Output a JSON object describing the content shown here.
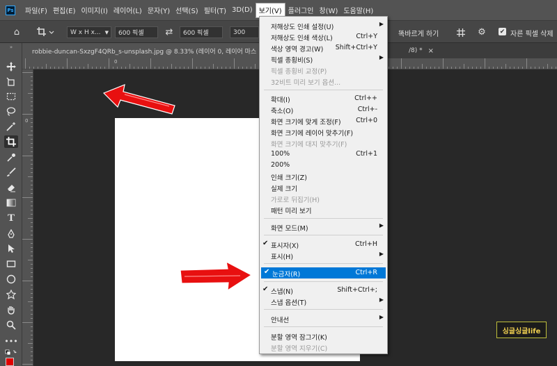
{
  "menubar": {
    "logo": "Ps",
    "items": [
      "파일(F)",
      "편집(E)",
      "이미지(I)",
      "레이어(L)",
      "문자(Y)",
      "선택(S)",
      "필터(T)",
      "3D(D)",
      "보기(V)",
      "플러그인",
      "창(W)",
      "도움말(H)"
    ],
    "active_index": 8
  },
  "options_bar": {
    "ratio_select": "W x H x...",
    "width_value": "600 픽셀",
    "height_value": "600 픽셀",
    "resolution_value": "300",
    "straighten_label": "똑바르게 하기",
    "delete_cropped_label": "자른 픽셀 삭제"
  },
  "tab": {
    "title": "robbie-duncan-SxzgF4QRb_s-unsplash.jpg @ 8.33% (레이어 0, 레이어 마스",
    "tail": "/8) *",
    "close": "×"
  },
  "rulers": {
    "top_numbers": [
      "0"
    ],
    "left_numbers": [
      "0"
    ]
  },
  "view_menu": {
    "items": [
      {
        "label": "저해상도 인쇄 설정(U)",
        "shortcut": "",
        "submenu": true,
        "disabled": false,
        "checked": false
      },
      {
        "label": "저해상도 인쇄 색상(L)",
        "shortcut": "Ctrl+Y",
        "submenu": false,
        "disabled": false,
        "checked": false
      },
      {
        "label": "색상 영역 경고(W)",
        "shortcut": "Shift+Ctrl+Y",
        "submenu": false,
        "disabled": false,
        "checked": false
      },
      {
        "label": "픽셀 종횡비(S)",
        "shortcut": "",
        "submenu": true,
        "disabled": false,
        "checked": false
      },
      {
        "label": "픽셀 종횡비 교정(P)",
        "shortcut": "",
        "submenu": false,
        "disabled": true,
        "checked": false
      },
      {
        "label": "32비트 미리 보기 옵션...",
        "shortcut": "",
        "submenu": false,
        "disabled": true,
        "checked": false
      },
      {
        "label": "확대(I)",
        "shortcut": "Ctrl++",
        "submenu": false,
        "disabled": false,
        "checked": false
      },
      {
        "label": "축소(O)",
        "shortcut": "Ctrl+-",
        "submenu": false,
        "disabled": false,
        "checked": false
      },
      {
        "label": "화면 크기에 맞게 조정(F)",
        "shortcut": "Ctrl+0",
        "submenu": false,
        "disabled": false,
        "checked": false
      },
      {
        "label": "화면 크기에 레이어 맞추기(F)",
        "shortcut": "",
        "submenu": false,
        "disabled": false,
        "checked": false
      },
      {
        "label": "화면 크기에 대지 맞추기(F)",
        "shortcut": "",
        "submenu": false,
        "disabled": true,
        "checked": false
      },
      {
        "label": "100%",
        "shortcut": "Ctrl+1",
        "submenu": false,
        "disabled": false,
        "checked": false
      },
      {
        "label": "200%",
        "shortcut": "",
        "submenu": false,
        "disabled": false,
        "checked": false
      },
      {
        "label": "인쇄 크기(Z)",
        "shortcut": "",
        "submenu": false,
        "disabled": false,
        "checked": false
      },
      {
        "label": "실제 크기",
        "shortcut": "",
        "submenu": false,
        "disabled": false,
        "checked": false
      },
      {
        "label": "가로로 뒤집기(H)",
        "shortcut": "",
        "submenu": false,
        "disabled": true,
        "checked": false
      },
      {
        "label": "패턴 미리 보기",
        "shortcut": "",
        "submenu": false,
        "disabled": false,
        "checked": false
      },
      {
        "label": "화면 모드(M)",
        "shortcut": "",
        "submenu": true,
        "disabled": false,
        "checked": false
      },
      {
        "label": "표시자(X)",
        "shortcut": "Ctrl+H",
        "submenu": false,
        "disabled": false,
        "checked": true
      },
      {
        "label": "표시(H)",
        "shortcut": "",
        "submenu": true,
        "disabled": false,
        "checked": false
      },
      {
        "label": "눈금자(R)",
        "shortcut": "Ctrl+R",
        "submenu": false,
        "disabled": false,
        "checked": true,
        "highlighted": true
      },
      {
        "label": "스냅(N)",
        "shortcut": "Shift+Ctrl+;",
        "submenu": false,
        "disabled": false,
        "checked": true
      },
      {
        "label": "스냅 옵션(T)",
        "shortcut": "",
        "submenu": true,
        "disabled": false,
        "checked": false
      },
      {
        "label": "안내선",
        "shortcut": "",
        "submenu": true,
        "disabled": false,
        "checked": false
      },
      {
        "label": "분할 영역 잠그기(K)",
        "shortcut": "",
        "submenu": false,
        "disabled": false,
        "checked": false
      },
      {
        "label": "분할 영역 지우기(C)",
        "shortcut": "",
        "submenu": false,
        "disabled": true,
        "checked": false
      }
    ],
    "check_glyph": "✔",
    "submenu_glyph": "▶"
  },
  "watermark": "싱글싱글life",
  "colors": {
    "highlight": "#0078d7",
    "arrow": "#e81010",
    "foreground": "#e10000"
  },
  "icons": {
    "home": "⌂",
    "crop": "⌐",
    "swap": "⇄",
    "grid": "#",
    "gear": "⚙"
  }
}
